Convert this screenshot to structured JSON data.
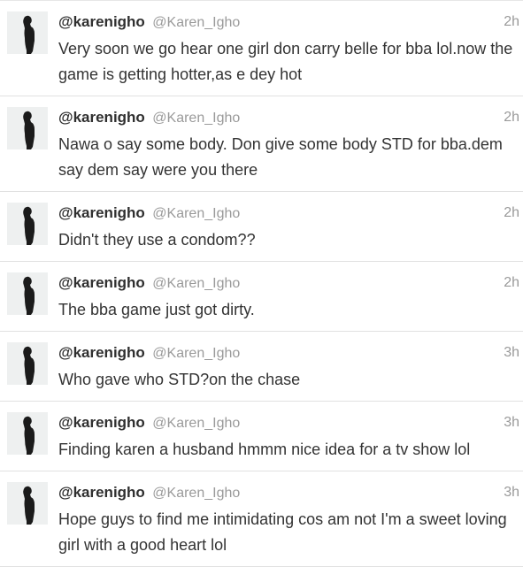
{
  "tweets": [
    {
      "handle": "@karenigho",
      "screen_name": "@Karen_Igho",
      "time": "2h",
      "text": "Very soon we go hear one girl don carry belle for bba lol.now the game is getting hotter,as e dey hot"
    },
    {
      "handle": "@karenigho",
      "screen_name": "@Karen_Igho",
      "time": "2h",
      "text": "Nawa o say some body. Don give some body STD for bba.dem say dem say were you there"
    },
    {
      "handle": "@karenigho",
      "screen_name": "@Karen_Igho",
      "time": "2h",
      "text": "Didn't they use a condom??"
    },
    {
      "handle": "@karenigho",
      "screen_name": "@Karen_Igho",
      "time": "2h",
      "text": "The bba game just got dirty."
    },
    {
      "handle": "@karenigho",
      "screen_name": "@Karen_Igho",
      "time": "3h",
      "text": "Who gave who STD?on the chase"
    },
    {
      "handle": "@karenigho",
      "screen_name": "@Karen_Igho",
      "time": "3h",
      "text": "Finding karen a husband hmmm nice idea for a tv show lol"
    },
    {
      "handle": "@karenigho",
      "screen_name": "@Karen_Igho",
      "time": "3h",
      "text": "Hope guys to find me intimidating cos am not I'm a sweet loving girl with a good heart lol"
    }
  ]
}
